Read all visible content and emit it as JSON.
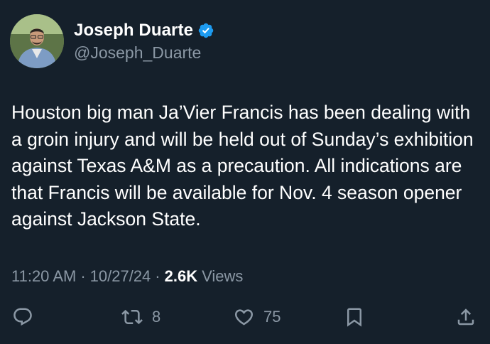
{
  "author": {
    "display_name": "Joseph Duarte",
    "handle": "@Joseph_Duarte",
    "verified": true
  },
  "tweet": {
    "text": "Houston big man Ja’Vier Francis has been dealing with a groin injury and will be held out of Sunday’s exhibition against Texas A&M as a precaution. All indications are that Francis will be available for Nov. 4 season opener against Jackson State."
  },
  "meta": {
    "time": "11:20 AM",
    "date": "10/27/24",
    "separator": "·",
    "views_count": "2.6K",
    "views_label": "Views"
  },
  "actions": {
    "reply": {
      "icon": "reply-icon"
    },
    "retweet": {
      "icon": "retweet-icon",
      "count": "8"
    },
    "like": {
      "icon": "heart-icon",
      "count": "75"
    },
    "bookmark": {
      "icon": "bookmark-icon"
    },
    "share": {
      "icon": "share-icon"
    }
  },
  "colors": {
    "background": "#15202b",
    "text": "#ffffff",
    "secondary": "#8b98a5",
    "verified": "#1d9bf0"
  }
}
